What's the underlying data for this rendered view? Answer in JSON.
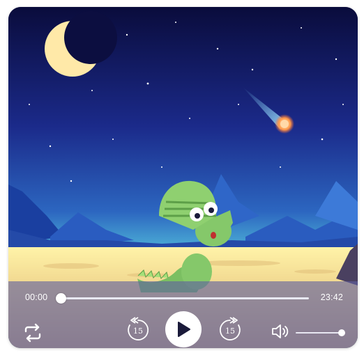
{
  "player": {
    "current_time": "00:00",
    "duration": "23:42",
    "progress": 0.0,
    "volume": 1.0,
    "rewind_seconds": "15",
    "forward_seconds": "15",
    "state": "paused"
  },
  "icons": {
    "repeat": "repeat-icon",
    "rewind": "rewind-15-icon",
    "play": "play-icon",
    "forward": "forward-15-icon",
    "volume": "volume-icon"
  },
  "colors": {
    "controls_overlay": "#6060a0",
    "control_fg": "#ffffff",
    "play_glyph": "#1a1a3a"
  }
}
